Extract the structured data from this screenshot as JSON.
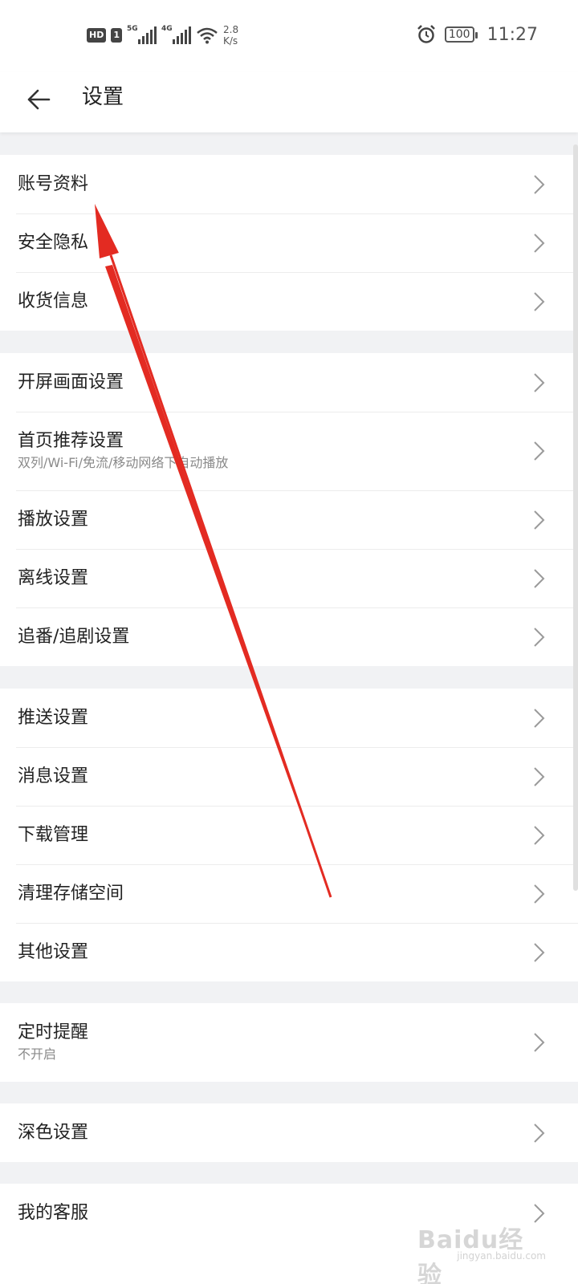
{
  "status_bar": {
    "badge_hd": "HD",
    "badge_sim": "1",
    "net_1": "5G",
    "net_2": "4G",
    "speed_value": "2.8",
    "speed_unit": "K/s",
    "battery": "100",
    "time": "11:27"
  },
  "header": {
    "title": "设置"
  },
  "groups": [
    {
      "items": [
        {
          "label": "账号资料"
        },
        {
          "label": "安全隐私"
        },
        {
          "label": "收货信息"
        }
      ]
    },
    {
      "items": [
        {
          "label": "开屏画面设置"
        },
        {
          "label": "首页推荐设置",
          "sub": "双列/Wi-Fi/免流/移动网络下自动播放"
        },
        {
          "label": "播放设置"
        },
        {
          "label": "离线设置"
        },
        {
          "label": "追番/追剧设置"
        }
      ]
    },
    {
      "items": [
        {
          "label": "推送设置"
        },
        {
          "label": "消息设置"
        },
        {
          "label": "下载管理"
        },
        {
          "label": "清理存储空间"
        },
        {
          "label": "其他设置"
        }
      ]
    },
    {
      "items": [
        {
          "label": "定时提醒",
          "sub": "不开启"
        }
      ]
    },
    {
      "items": [
        {
          "label": "深色设置"
        }
      ]
    },
    {
      "items": [
        {
          "label": "我的客服"
        }
      ]
    }
  ],
  "watermark": {
    "logo": "Baidu经验",
    "url": "jingyan.baidu.com"
  },
  "colors": {
    "background": "#f1f2f4",
    "surface": "#ffffff",
    "annotation_arrow": "#e32b22",
    "chevron": "#9a9a9a"
  }
}
